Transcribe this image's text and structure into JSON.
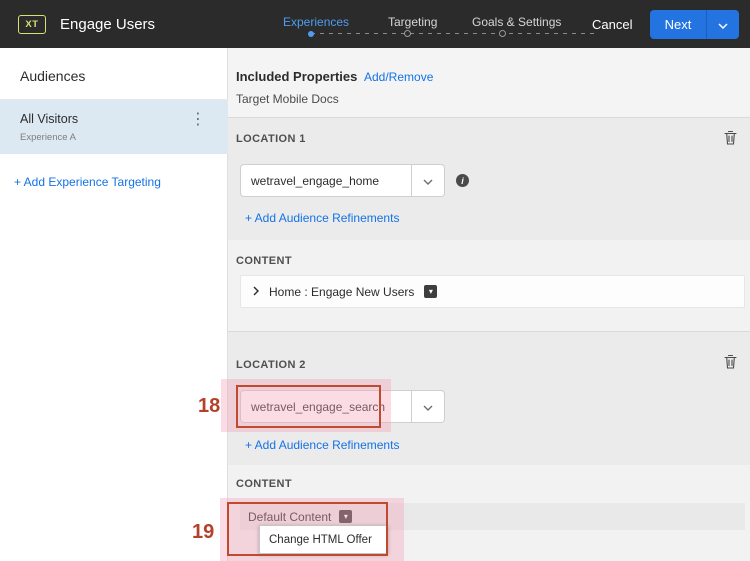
{
  "colors": {
    "topbar_bg": "#2b2b2b",
    "accent_blue": "#1473e6",
    "step_active_blue": "#4f9cf0",
    "next_button_blue": "#2373e0",
    "selected_audience_bg": "#dde9f2",
    "annotation_orange": "#c04a2e",
    "annotation_pink": "#f6a4b7"
  },
  "topbar": {
    "badge": "XT",
    "title": "Engage Users",
    "steps": [
      {
        "label": "Experiences",
        "active": true
      },
      {
        "label": "Targeting",
        "active": false
      },
      {
        "label": "Goals & Settings",
        "active": false
      }
    ],
    "cancel_label": "Cancel",
    "next_label": "Next"
  },
  "sidebar": {
    "heading": "Audiences",
    "items": [
      {
        "title": "All Visitors",
        "subtitle": "Experience A",
        "selected": true
      }
    ],
    "add_link": "+ Add Experience Targeting"
  },
  "main": {
    "included_properties": {
      "label": "Included Properties",
      "action_link": "Add/Remove",
      "value": "Target Mobile Docs"
    },
    "locations": [
      {
        "label": "LOCATION 1",
        "input_value": "wetravel_engage_home",
        "refinements_link": "+ Add Audience Refinements",
        "content_label": "CONTENT",
        "content_value": "Home : Engage New Users"
      },
      {
        "label": "LOCATION 2",
        "input_value": "wetravel_engage_search",
        "refinements_link": "+ Add Audience Refinements",
        "content_label": "CONTENT",
        "content_value": "Default Content"
      }
    ],
    "content_menu": {
      "items": [
        {
          "label": "Change HTML Offer"
        }
      ]
    }
  },
  "annotations": {
    "callout_18": "18",
    "callout_19": "19"
  },
  "icons": {
    "kebab": "⋮",
    "info": "i",
    "popout": "▾"
  }
}
